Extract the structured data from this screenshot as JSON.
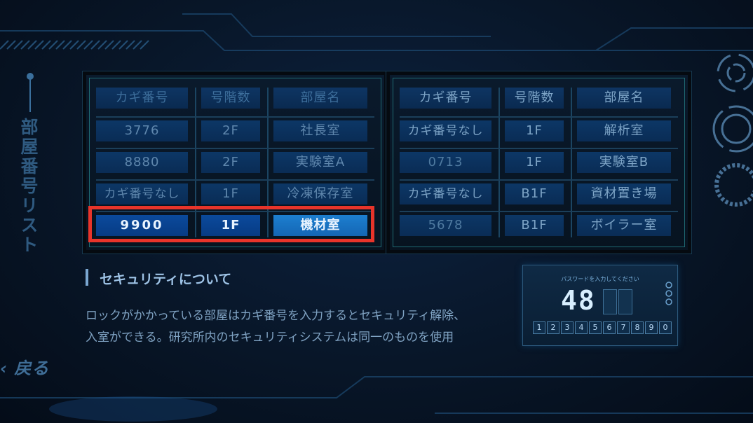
{
  "screen": {
    "vertical_title": "部屋番号リスト",
    "back_label": "戻る",
    "back_icon": "‹"
  },
  "left_table": {
    "headers": [
      "カギ番号",
      "号階数",
      "部屋名"
    ],
    "rows": [
      [
        "3776",
        "2F",
        "社長室"
      ],
      [
        "8880",
        "2F",
        "実験室A"
      ],
      [
        "カギ番号なし",
        "1F",
        "冷凍保存室"
      ],
      [
        "9900",
        "1F",
        "機材室"
      ]
    ]
  },
  "right_table": {
    "headers": [
      "カギ番号",
      "号階数",
      "部屋名"
    ],
    "rows": [
      [
        "カギ番号なし",
        "1F",
        "解析室"
      ],
      [
        "0713",
        "1F",
        "実験室B"
      ],
      [
        "カギ番号なし",
        "B1F",
        "資材置き場"
      ],
      [
        "5678",
        "B1F",
        "ボイラー室"
      ]
    ]
  },
  "selected_row": "9900",
  "security": {
    "title": "セキュリティについて",
    "line1": "ロックがかかっている部屋はカギ番号を入力するとセキュリティ解除、",
    "line2": "入室ができる。研究所内のセキュリティシステムは同一のものを使用"
  },
  "keypad": {
    "label": "パスワードを入力してください",
    "entered": "48",
    "keys": [
      "1",
      "2",
      "3",
      "4",
      "5",
      "6",
      "7",
      "8",
      "9",
      "0"
    ]
  },
  "colors": {
    "highlight": "#e8342a",
    "selected_cell": "#1466b4",
    "frame": "#1f6a72"
  }
}
